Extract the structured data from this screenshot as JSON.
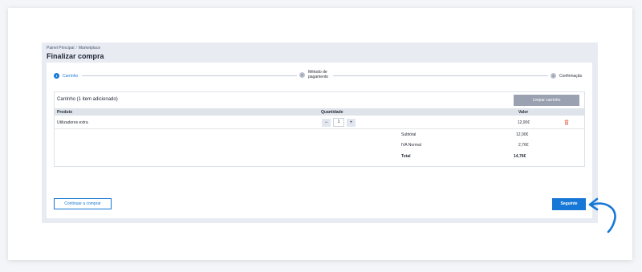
{
  "breadcrumb": {
    "home": "Painel Principal",
    "current": "Marketplace"
  },
  "page_title": "Finalizar compra",
  "steps": [
    {
      "number": "1",
      "label": "Carrinho"
    },
    {
      "number": "2",
      "label_line1": "Método de",
      "label_line2": "pagamento"
    },
    {
      "number": "2",
      "label": "Confirmação"
    }
  ],
  "cart": {
    "title": "Carrinho (1 item adicionado)",
    "clear_label": "Limpar carrinho",
    "columns": {
      "product": "Produto",
      "quantity": "Quantidade",
      "value": "Valor"
    },
    "items": [
      {
        "name": "Utilizadores extra",
        "quantity": "1",
        "value": "12,00€",
        "minus": "−",
        "plus": "+"
      }
    ],
    "summary": {
      "subtotal_label": "Subtotal",
      "subtotal_value": "12,00€",
      "tax_label": "IVA Normal",
      "tax_value": "2,76€",
      "total_label": "Total",
      "total_value": "14,76€"
    }
  },
  "actions": {
    "continue_label": "Continuar a comprar",
    "next_label": "Seguinte"
  },
  "colors": {
    "primary": "#1677d6",
    "muted_button": "#9aa2b1",
    "delete": "#e0533b"
  },
  "icons": {
    "delete": "trash-icon",
    "annotation": "curved-arrow-icon"
  }
}
